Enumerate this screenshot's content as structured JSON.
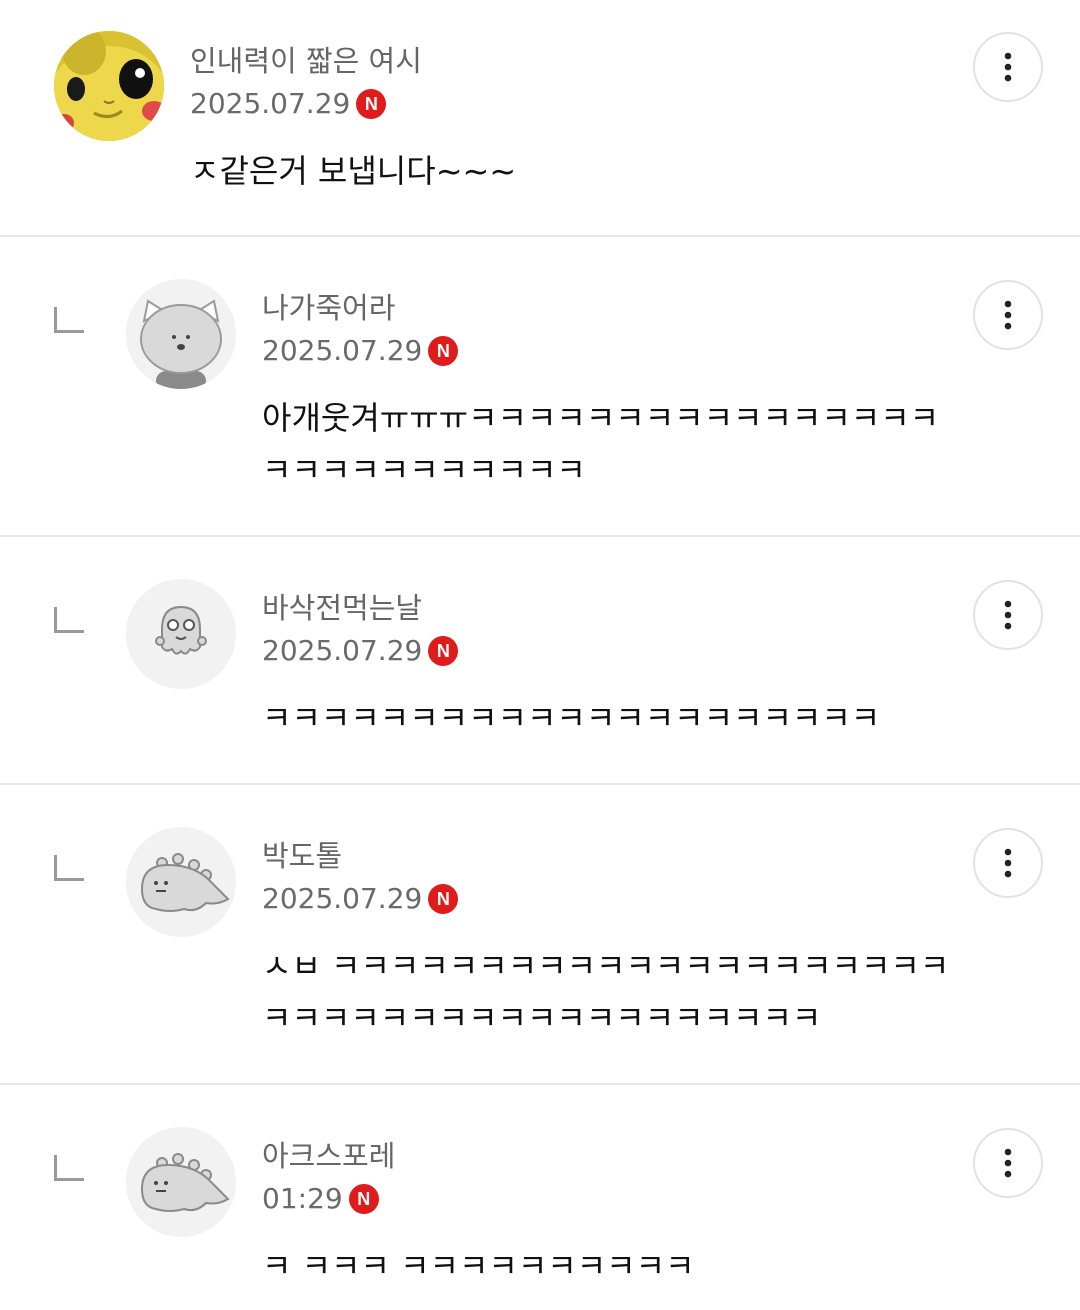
{
  "comments": [
    {
      "author": "인내력이 짧은 여시",
      "date": "2025.07.29",
      "badge": "N",
      "text": "ㅈ같은거 보냅니다~~~",
      "avatar": "pikachu-plush-avatar-icon",
      "is_reply": false
    },
    {
      "author": "나가죽어라",
      "date": "2025.07.29",
      "badge": "N",
      "text": "아개웃겨ㅠㅠㅠㅋㅋㅋㅋㅋㅋㅋㅋㅋㅋㅋㅋㅋㅋㅋㅋㅋㅋㅋㅋㅋㅋㅋㅋㅋㅋㅋ",
      "avatar": "cat-default-avatar-icon",
      "is_reply": true
    },
    {
      "author": "바삭전먹는날",
      "date": "2025.07.29",
      "badge": "N",
      "text": "ㅋㅋㅋㅋㅋㅋㅋㅋㅋㅋㅋㅋㅋㅋㅋㅋㅋㅋㅋㅋㅋ",
      "avatar": "ghost-default-avatar-icon",
      "is_reply": true
    },
    {
      "author": "박도톨",
      "date": "2025.07.29",
      "badge": "N",
      "text": "ㅅㅂ ㅋㅋㅋㅋㅋㅋㅋㅋㅋㅋㅋㅋㅋㅋㅋㅋㅋㅋㅋㅋㅋㅋㅋㅋㅋㅋㅋㅋㅋㅋㅋㅋㅋㅋㅋㅋㅋㅋㅋㅋ",
      "avatar": "dino-default-avatar-icon",
      "is_reply": true
    },
    {
      "author": "아크스포레",
      "date": "01:29",
      "badge": "N",
      "text": "ㅋ ㅋㅋㅋ ㅋㅋㅋㅋㅋㅋㅋㅋㅋㅋ",
      "avatar": "dino-default-avatar-icon",
      "is_reply": true
    }
  ],
  "colors": {
    "badge": "#e01b1b",
    "author": "#666666",
    "divider": "#e6e6e6",
    "text": "#111111"
  }
}
